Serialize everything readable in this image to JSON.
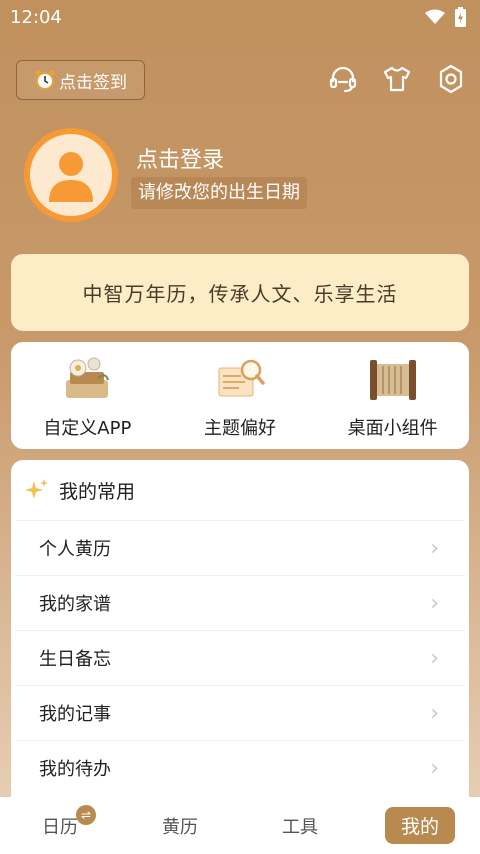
{
  "status_bar": {
    "time": "12:04"
  },
  "header": {
    "checkin_label": "点击签到",
    "icons": [
      "customer-service-icon",
      "theme-shirt-icon",
      "settings-gear-icon"
    ]
  },
  "profile": {
    "login_label": "点击登录",
    "birth_tip": "请修改您的出生日期"
  },
  "slogan": "中智万年历，传承人文、乐享生活",
  "features": [
    {
      "label": "自定义APP",
      "icon": "custom-app-icon"
    },
    {
      "label": "主题偏好",
      "icon": "theme-preference-icon"
    },
    {
      "label": "桌面小组件",
      "icon": "desktop-widget-icon"
    }
  ],
  "favorites": {
    "title": "我的常用",
    "items": [
      {
        "label": "个人黄历"
      },
      {
        "label": "我的家谱"
      },
      {
        "label": "生日备忘"
      },
      {
        "label": "我的记事"
      },
      {
        "label": "我的待办"
      }
    ]
  },
  "tabs": [
    {
      "label": "日历"
    },
    {
      "label": "黄历"
    },
    {
      "label": "工具"
    },
    {
      "label": "我的",
      "active": true
    }
  ],
  "colors": {
    "accent": "#b98a50",
    "avatar_ring": "#f79a35",
    "slogan_bg": "#fcedc6"
  }
}
